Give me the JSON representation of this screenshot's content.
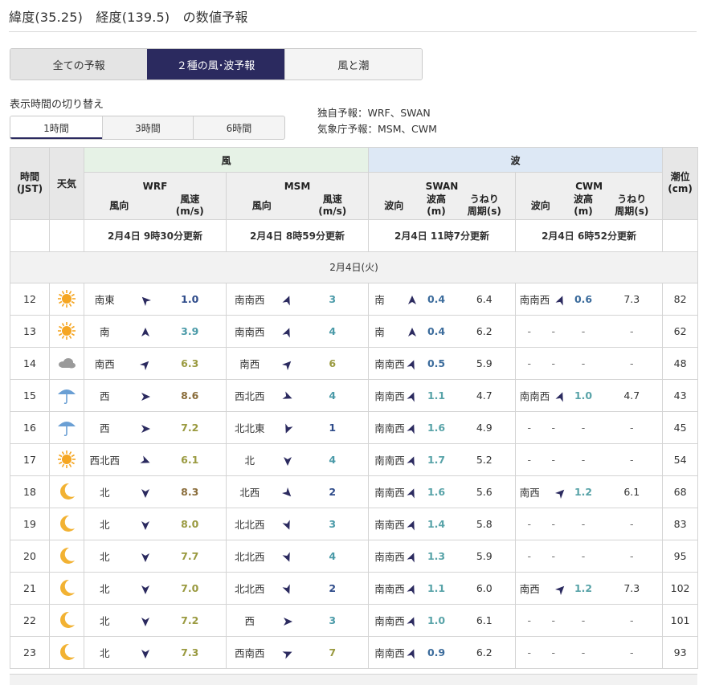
{
  "page": {
    "title": "緯度(35.25)　経度(139.5)　の数値予報"
  },
  "tabs": [
    {
      "label": "全ての予報"
    },
    {
      "label": "２種の風･波予報"
    },
    {
      "label": "風と潮"
    }
  ],
  "time_switch": {
    "label": "表示時間の切り替え",
    "options": [
      "1時間",
      "3時間",
      "6時間"
    ],
    "selected": "1時間"
  },
  "models": {
    "own": "独自予報：WRF、SWAN",
    "jma": "気象庁予報：MSM、CWM"
  },
  "table": {
    "headers": {
      "time": "時間\n(JST)",
      "weather": "天気",
      "wind": "風",
      "wave": "波",
      "tide": "潮位\n(cm)",
      "wrf": "WRF",
      "msm": "MSM",
      "swan": "SWAN",
      "cwm": "CWM",
      "wind_dir": "風向",
      "wind_speed": "風速\n(m/s)",
      "wave_dir": "波向",
      "wave_height": "波高\n(m)",
      "swell_period": "うねり\n周期(s)"
    },
    "updates": {
      "wrf": "2月4日 9時30分更新",
      "msm": "2月4日 8時59分更新",
      "swan": "2月4日 11時7分更新",
      "cwm": "2月4日 6時52分更新"
    },
    "day_label": "2月4日(火)",
    "rows": [
      {
        "hour": "12",
        "weather": "sun",
        "wrf_dir": "南東",
        "wrf_deg": 315,
        "wrf_spd": "1.0",
        "wrf_c": "sp-blue",
        "msm_dir": "南南西",
        "msm_deg": 22,
        "msm_spd": "3",
        "msm_c": "sp-teal",
        "swan_dir": "南",
        "swan_deg": 0,
        "swan_h": "0.4",
        "swan_c": "wh-blue",
        "swan_p": "6.4",
        "cwm_dir": "南南西",
        "cwm_deg": 22,
        "cwm_h": "0.6",
        "cwm_c": "wh-blue",
        "cwm_p": "7.3",
        "tide": "82"
      },
      {
        "hour": "13",
        "weather": "sun",
        "wrf_dir": "南",
        "wrf_deg": 0,
        "wrf_spd": "3.9",
        "wrf_c": "sp-teal",
        "msm_dir": "南南西",
        "msm_deg": 22,
        "msm_spd": "4",
        "msm_c": "sp-teal",
        "swan_dir": "南",
        "swan_deg": 0,
        "swan_h": "0.4",
        "swan_c": "wh-blue",
        "swan_p": "6.2",
        "cwm_dir": "-",
        "cwm_h": "-",
        "cwm_p": "-",
        "tide": "62"
      },
      {
        "hour": "14",
        "weather": "cloud",
        "wrf_dir": "南西",
        "wrf_deg": 45,
        "wrf_spd": "6.3",
        "wrf_c": "sp-olive",
        "msm_dir": "南西",
        "msm_deg": 45,
        "msm_spd": "6",
        "msm_c": "sp-olive",
        "swan_dir": "南南西",
        "swan_deg": 22,
        "swan_h": "0.5",
        "swan_c": "wh-blue",
        "swan_p": "5.9",
        "cwm_dir": "-",
        "cwm_h": "-",
        "cwm_p": "-",
        "tide": "48"
      },
      {
        "hour": "15",
        "weather": "rain",
        "wrf_dir": "西",
        "wrf_deg": 90,
        "wrf_spd": "8.6",
        "wrf_c": "sp-brown",
        "msm_dir": "西北西",
        "msm_deg": 112,
        "msm_spd": "4",
        "msm_c": "sp-teal",
        "swan_dir": "南南西",
        "swan_deg": 22,
        "swan_h": "1.1",
        "swan_c": "wh-teal",
        "swan_p": "4.7",
        "cwm_dir": "南南西",
        "cwm_deg": 22,
        "cwm_h": "1.0",
        "cwm_c": "wh-teal",
        "cwm_p": "4.7",
        "tide": "43"
      },
      {
        "hour": "16",
        "weather": "rain",
        "wrf_dir": "西",
        "wrf_deg": 90,
        "wrf_spd": "7.2",
        "wrf_c": "sp-olive",
        "msm_dir": "北北東",
        "msm_deg": 202,
        "msm_spd": "1",
        "msm_c": "sp-blue",
        "swan_dir": "南南西",
        "swan_deg": 22,
        "swan_h": "1.6",
        "swan_c": "wh-teal",
        "swan_p": "4.9",
        "cwm_dir": "-",
        "cwm_h": "-",
        "cwm_p": "-",
        "tide": "45"
      },
      {
        "hour": "17",
        "weather": "sun",
        "wrf_dir": "西北西",
        "wrf_deg": 112,
        "wrf_spd": "6.1",
        "wrf_c": "sp-olive",
        "msm_dir": "北",
        "msm_deg": 180,
        "msm_spd": "4",
        "msm_c": "sp-teal",
        "swan_dir": "南南西",
        "swan_deg": 22,
        "swan_h": "1.7",
        "swan_c": "wh-teal",
        "swan_p": "5.2",
        "cwm_dir": "-",
        "cwm_h": "-",
        "cwm_p": "-",
        "tide": "54"
      },
      {
        "hour": "18",
        "weather": "moon",
        "wrf_dir": "北",
        "wrf_deg": 180,
        "wrf_spd": "8.3",
        "wrf_c": "sp-brown",
        "msm_dir": "北西",
        "msm_deg": 135,
        "msm_spd": "2",
        "msm_c": "sp-blue",
        "swan_dir": "南南西",
        "swan_deg": 22,
        "swan_h": "1.6",
        "swan_c": "wh-teal",
        "swan_p": "5.6",
        "cwm_dir": "南西",
        "cwm_deg": 45,
        "cwm_h": "1.2",
        "cwm_c": "wh-teal",
        "cwm_p": "6.1",
        "tide": "68"
      },
      {
        "hour": "19",
        "weather": "moon",
        "wrf_dir": "北",
        "wrf_deg": 180,
        "wrf_spd": "8.0",
        "wrf_c": "sp-olive",
        "msm_dir": "北北西",
        "msm_deg": 158,
        "msm_spd": "3",
        "msm_c": "sp-teal",
        "swan_dir": "南南西",
        "swan_deg": 22,
        "swan_h": "1.4",
        "swan_c": "wh-teal",
        "swan_p": "5.8",
        "cwm_dir": "-",
        "cwm_h": "-",
        "cwm_p": "-",
        "tide": "83"
      },
      {
        "hour": "20",
        "weather": "moon",
        "wrf_dir": "北",
        "wrf_deg": 180,
        "wrf_spd": "7.7",
        "wrf_c": "sp-olive",
        "msm_dir": "北北西",
        "msm_deg": 158,
        "msm_spd": "4",
        "msm_c": "sp-teal",
        "swan_dir": "南南西",
        "swan_deg": 22,
        "swan_h": "1.3",
        "swan_c": "wh-teal",
        "swan_p": "5.9",
        "cwm_dir": "-",
        "cwm_h": "-",
        "cwm_p": "-",
        "tide": "95"
      },
      {
        "hour": "21",
        "weather": "moon",
        "wrf_dir": "北",
        "wrf_deg": 180,
        "wrf_spd": "7.0",
        "wrf_c": "sp-olive",
        "msm_dir": "北北西",
        "msm_deg": 158,
        "msm_spd": "2",
        "msm_c": "sp-blue",
        "swan_dir": "南南西",
        "swan_deg": 22,
        "swan_h": "1.1",
        "swan_c": "wh-teal",
        "swan_p": "6.0",
        "cwm_dir": "南西",
        "cwm_deg": 45,
        "cwm_h": "1.2",
        "cwm_c": "wh-teal",
        "cwm_p": "7.3",
        "tide": "102"
      },
      {
        "hour": "22",
        "weather": "moon",
        "wrf_dir": "北",
        "wrf_deg": 180,
        "wrf_spd": "7.2",
        "wrf_c": "sp-olive",
        "msm_dir": "西",
        "msm_deg": 90,
        "msm_spd": "3",
        "msm_c": "sp-teal",
        "swan_dir": "南南西",
        "swan_deg": 22,
        "swan_h": "1.0",
        "swan_c": "wh-teal",
        "swan_p": "6.1",
        "cwm_dir": "-",
        "cwm_h": "-",
        "cwm_p": "-",
        "tide": "101"
      },
      {
        "hour": "23",
        "weather": "moon",
        "wrf_dir": "北",
        "wrf_deg": 180,
        "wrf_spd": "7.3",
        "wrf_c": "sp-olive",
        "msm_dir": "西南西",
        "msm_deg": 67,
        "msm_spd": "7",
        "msm_c": "sp-olive",
        "swan_dir": "南南西",
        "swan_deg": 22,
        "swan_h": "0.9",
        "swan_c": "wh-blue",
        "swan_p": "6.2",
        "cwm_dir": "-",
        "cwm_h": "-",
        "cwm_p": "-",
        "tide": "93"
      }
    ]
  },
  "colors": {
    "accent": "#2b2a5f",
    "wind_header": "#e6f2e6",
    "wave_header": "#dde8f5",
    "arrow": "#2b2a5f",
    "sun": "#f5a623",
    "moon": "#f2b233",
    "cloud": "#9a9a9a",
    "umbrella": "#6a9fd4"
  }
}
